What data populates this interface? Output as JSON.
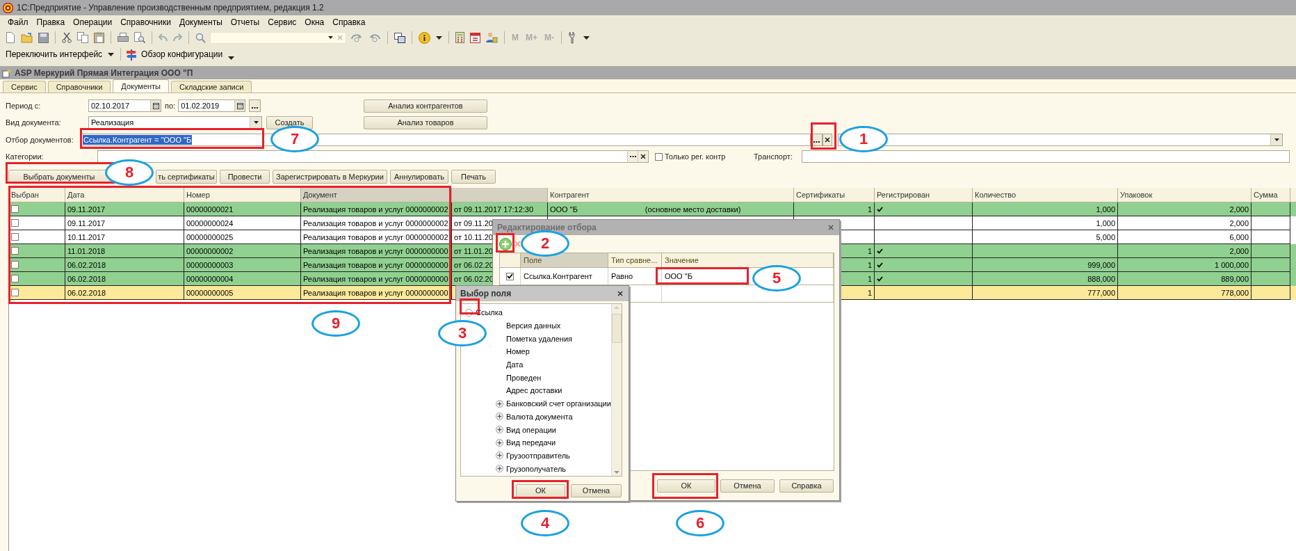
{
  "app_title": "1С:Предприятие - Управление производственным предприятием, редакция 1.2",
  "menu": [
    "Файл",
    "Правка",
    "Операции",
    "Справочники",
    "Документы",
    "Отчеты",
    "Сервис",
    "Окна",
    "Справка"
  ],
  "toolbar": {
    "memory_buttons": [
      "M",
      "M+",
      "M-"
    ]
  },
  "toolbar2": {
    "interface_switch": "Переключить интерфейс",
    "config_overview": "Обзор конфигурации"
  },
  "window": {
    "title": "ASP Меркурий Прямая Интеграция ООО \"П"
  },
  "tabs": [
    {
      "label": "Сервис",
      "selected": false
    },
    {
      "label": "Справочники",
      "selected": false
    },
    {
      "label": "Документы",
      "selected": true
    },
    {
      "label": "Складские записи",
      "selected": false
    }
  ],
  "form": {
    "period_label": "Период с:",
    "period_from": "02.10.2017",
    "period_to_label": "по:",
    "period_to": "01.02.2019",
    "doc_type_label": "Вид документа:",
    "doc_type": "Реализация",
    "create_button": "Создать",
    "analysis_buttons": [
      "Анализ контрагентов",
      "Анализ товаров"
    ],
    "filter_label": "Отбор документов:",
    "filter_value": "Ссылка.Контрагент = \"ООО \"Б",
    "filter_selected": true,
    "categories_label": "Категории:",
    "only_registered": {
      "label": "Только рег. контр",
      "checked": false
    },
    "transport_label": "Транспорт:"
  },
  "actions": [
    "Выбрать документы",
    "ть сертификаты",
    "Провести",
    "Зарегистрировать в Меркурии",
    "Аннулировать",
    "Печать"
  ],
  "table": {
    "columns": [
      {
        "label": "Выбран",
        "highlighted": false
      },
      {
        "label": "Дата",
        "highlighted": false
      },
      {
        "label": "Номер",
        "highlighted": false
      },
      {
        "label": "Документ",
        "highlighted": true
      },
      {
        "highlighted": true
      },
      {
        "label": "Контрагент",
        "highlighted": false
      },
      {
        "label": "Сертификаты",
        "highlighted": false
      },
      {
        "label": "Регистрирован",
        "highlighted": false
      },
      {
        "label": "Количество",
        "highlighted": false
      },
      {
        "label": "Упаковок",
        "highlighted": false
      },
      {
        "label": "Сумма",
        "highlighted": false
      }
    ],
    "rows": [
      {
        "checked": false,
        "color": "#90d090",
        "date": "09.11.2017",
        "number": "00000000021",
        "document": "Реализация товаров и услуг 0000000002",
        "document_date": "от 09.11.2017 17:12:30",
        "contractor": "ООО \"Б",
        "contractor_note": "(основное место доставки)",
        "certificates": "1",
        "registered": true,
        "quantity": "1,000",
        "packages": "2,000"
      },
      {
        "checked": false,
        "color": "#ffffff",
        "date": "09.11.2017",
        "number": "00000000024",
        "document": "Реализация товаров и услуг 0000000002",
        "document_date": "от 09.11.20",
        "registered": false,
        "quantity": "1,000",
        "packages": "2,000"
      },
      {
        "checked": false,
        "color": "#ffffff",
        "date": "10.11.2017",
        "number": "00000000025",
        "document": "Реализация товаров и услуг 0000000002",
        "document_date": "от 10.11.20",
        "registered": false,
        "quantity": "5,000",
        "packages": "6,000"
      },
      {
        "checked": false,
        "color": "#90d090",
        "date": "11.01.2018",
        "number": "00000000002",
        "document": "Реализация товаров и услуг 0000000000",
        "document_date": "от 11.01.20",
        "certificates": "1",
        "registered": true,
        "packages": "2,000"
      },
      {
        "checked": false,
        "color": "#90d090",
        "date": "06.02.2018",
        "number": "00000000003",
        "document": "Реализация товаров и услуг 0000000000",
        "document_date": "от 06.02.20",
        "certificates": "1",
        "registered": true,
        "quantity": "999,000",
        "packages": "1 000,000"
      },
      {
        "checked": false,
        "color": "#90d090",
        "date": "06.02.2018",
        "number": "00000000004",
        "document": "Реализация товаров и услуг 0000000000",
        "document_date": "от 06.02.20",
        "certificates": "1",
        "registered": true,
        "quantity": "888,000",
        "packages": "889,000"
      },
      {
        "checked": false,
        "color": "#fde99a",
        "date": "06.02.2018",
        "number": "00000000005",
        "document": "Реализация товаров и услуг 0000000000",
        "certificates": "1",
        "registered": false,
        "quantity": "777,000",
        "packages": "778,000"
      }
    ]
  },
  "filter_dialog": {
    "title": "Редактирование отбора",
    "columns": [
      {
        "label": "Поле",
        "highlighted": true
      },
      {
        "label": "Тип сравне...",
        "highlighted": false
      },
      {
        "label": "Значение",
        "highlighted": false
      }
    ],
    "rows": [
      {
        "enabled": true,
        "field": "Ссылка.Контрагент",
        "comparison": "Равно",
        "value": "ООО \"Б"
      }
    ],
    "buttons": [
      "ОК",
      "Отмена",
      "Справка"
    ]
  },
  "field_dialog": {
    "title": "Выбор поля",
    "tree": [
      {
        "label": "Ссылка",
        "kind": "group",
        "expanded": true,
        "children": [
          {
            "label": "Версия данных",
            "kind": "leaf"
          },
          {
            "label": "Пометка удаления",
            "kind": "leaf"
          },
          {
            "label": "Номер",
            "kind": "leaf"
          },
          {
            "label": "Дата",
            "kind": "leaf"
          },
          {
            "label": "Проведен",
            "kind": "leaf"
          },
          {
            "label": "Адрес доставки",
            "kind": "leaf"
          },
          {
            "label": "Банковский счет организации",
            "kind": "group",
            "expanded": false
          },
          {
            "label": "Валюта документа",
            "kind": "group",
            "expanded": false
          },
          {
            "label": "Вид операции",
            "kind": "group",
            "expanded": false
          },
          {
            "label": "Вид передачи",
            "kind": "group",
            "expanded": false
          },
          {
            "label": "Грузоотправитель",
            "kind": "group",
            "expanded": false
          },
          {
            "label": "Грузополучатель",
            "kind": "group",
            "expanded": false
          }
        ]
      }
    ],
    "buttons": [
      "ОК",
      "Отмена"
    ]
  },
  "annotations": [
    {
      "number": "1"
    },
    {
      "number": "2"
    },
    {
      "number": "3"
    },
    {
      "number": "4"
    },
    {
      "number": "5"
    },
    {
      "number": "6"
    },
    {
      "number": "7"
    },
    {
      "number": "8"
    },
    {
      "number": "9"
    }
  ]
}
